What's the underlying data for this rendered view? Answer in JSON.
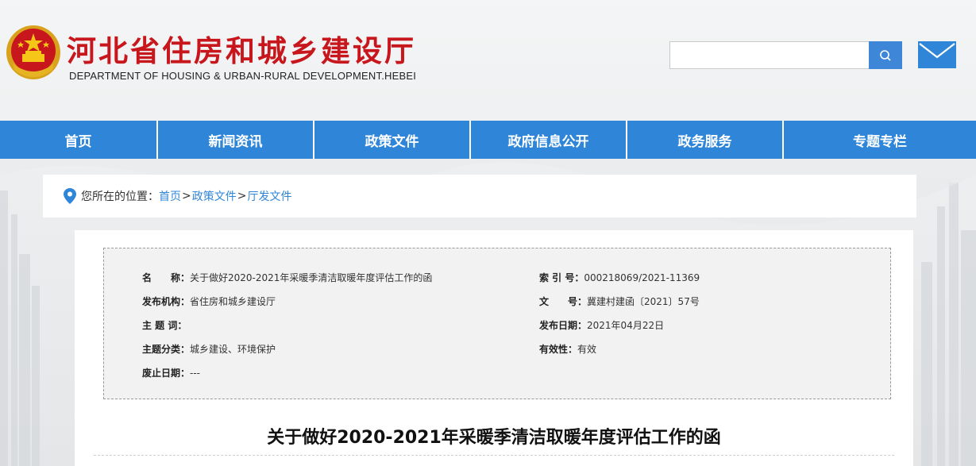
{
  "header": {
    "site_title": "河北省住房和城乡建设厅",
    "site_subtitle": "DEPARTMENT OF HOUSING & URBAN-RURAL DEVELOPMENT.HEBEI",
    "search": {
      "placeholder": "",
      "value": "",
      "icon": "search-icon"
    },
    "mail_icon": "mail-icon",
    "colors": {
      "brand_red": "#c8161d",
      "accent_blue": "#2f86d9"
    }
  },
  "nav": {
    "items": [
      {
        "label": "首页"
      },
      {
        "label": "新闻资讯"
      },
      {
        "label": "政策文件"
      },
      {
        "label": "政府信息公开"
      },
      {
        "label": "政务服务"
      },
      {
        "label": "专题专栏"
      }
    ]
  },
  "breadcrumb": {
    "prefix": "您所在的位置：",
    "links": [
      "首页",
      "政策文件",
      "厅发文件"
    ],
    "separator": ">"
  },
  "meta": {
    "name_key": "名　　称：",
    "name_val": "关于做好2020-2021年采暖季清洁取暖年度评估工作的函",
    "index_key": "索 引 号：",
    "index_val": "000218069/2021-11369",
    "org_key": "发布机构：",
    "org_val": "省住房和城乡建设厅",
    "docno_key": "文　　号：",
    "docno_val": "冀建村建函〔2021〕57号",
    "subject_key": "主 题 词：",
    "subject_val": "",
    "date_key": "发布日期：",
    "date_val": "2021年04月22日",
    "category_key": "主题分类：",
    "category_val": "城乡建设、环境保护",
    "valid_key": "有效性：",
    "valid_val": "有效",
    "expire_key": "废止日期：",
    "expire_val": "---"
  },
  "document": {
    "title": "关于做好2020-2021年采暖季清洁取暖年度评估工作的函"
  }
}
